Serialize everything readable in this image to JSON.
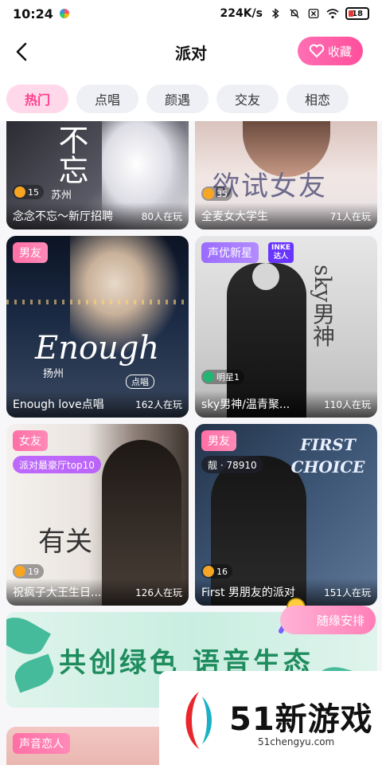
{
  "status_bar": {
    "time": "10:24",
    "network_speed": "224K/s",
    "battery": "18"
  },
  "nav": {
    "title": "派对",
    "favorite_label": "收藏"
  },
  "tabs": [
    {
      "label": "热门",
      "active": true
    },
    {
      "label": "点唱",
      "active": false
    },
    {
      "label": "颜遇",
      "active": false
    },
    {
      "label": "交友",
      "active": false
    },
    {
      "label": "相恋",
      "active": false
    }
  ],
  "rooms": [
    {
      "name": "念念不忘～新厅招聘",
      "count": "80人在玩",
      "level": "15",
      "art_text": "不忘",
      "location": "苏州"
    },
    {
      "name": "全麦女大学生",
      "count": "71人在玩",
      "level": "35",
      "art_text": "欲试女友"
    },
    {
      "name": "Enough love点唱",
      "count": "162人在玩",
      "tag": "男友",
      "art_text": "Enough",
      "location": "扬州",
      "sub_art": "点唱"
    },
    {
      "name": "sky男神/温青聚...",
      "count": "110人在玩",
      "tag": "声优新星",
      "inke": [
        "INKE",
        "达人"
      ],
      "level": "明星1",
      "art_text": "sky男神"
    },
    {
      "name": "祝疯子大王生日...",
      "count": "126人在玩",
      "tag": "女友",
      "sub_badge": "派对最豪厅top10",
      "level": "19",
      "art_text": "有关"
    },
    {
      "name": "First 男朋友的派对",
      "count": "151人在玩",
      "tag": "男友",
      "sub_badge": "靓 · 78910",
      "level": "16",
      "art_text": "FIRST CHOICE"
    }
  ],
  "banner": {
    "text": "共创绿色 语音生态",
    "random_label": "随缘安排"
  },
  "partial_card": {
    "tag": "声音恋人"
  },
  "watermark": {
    "brand": "51新游戏",
    "url": "51chengyu.com"
  }
}
